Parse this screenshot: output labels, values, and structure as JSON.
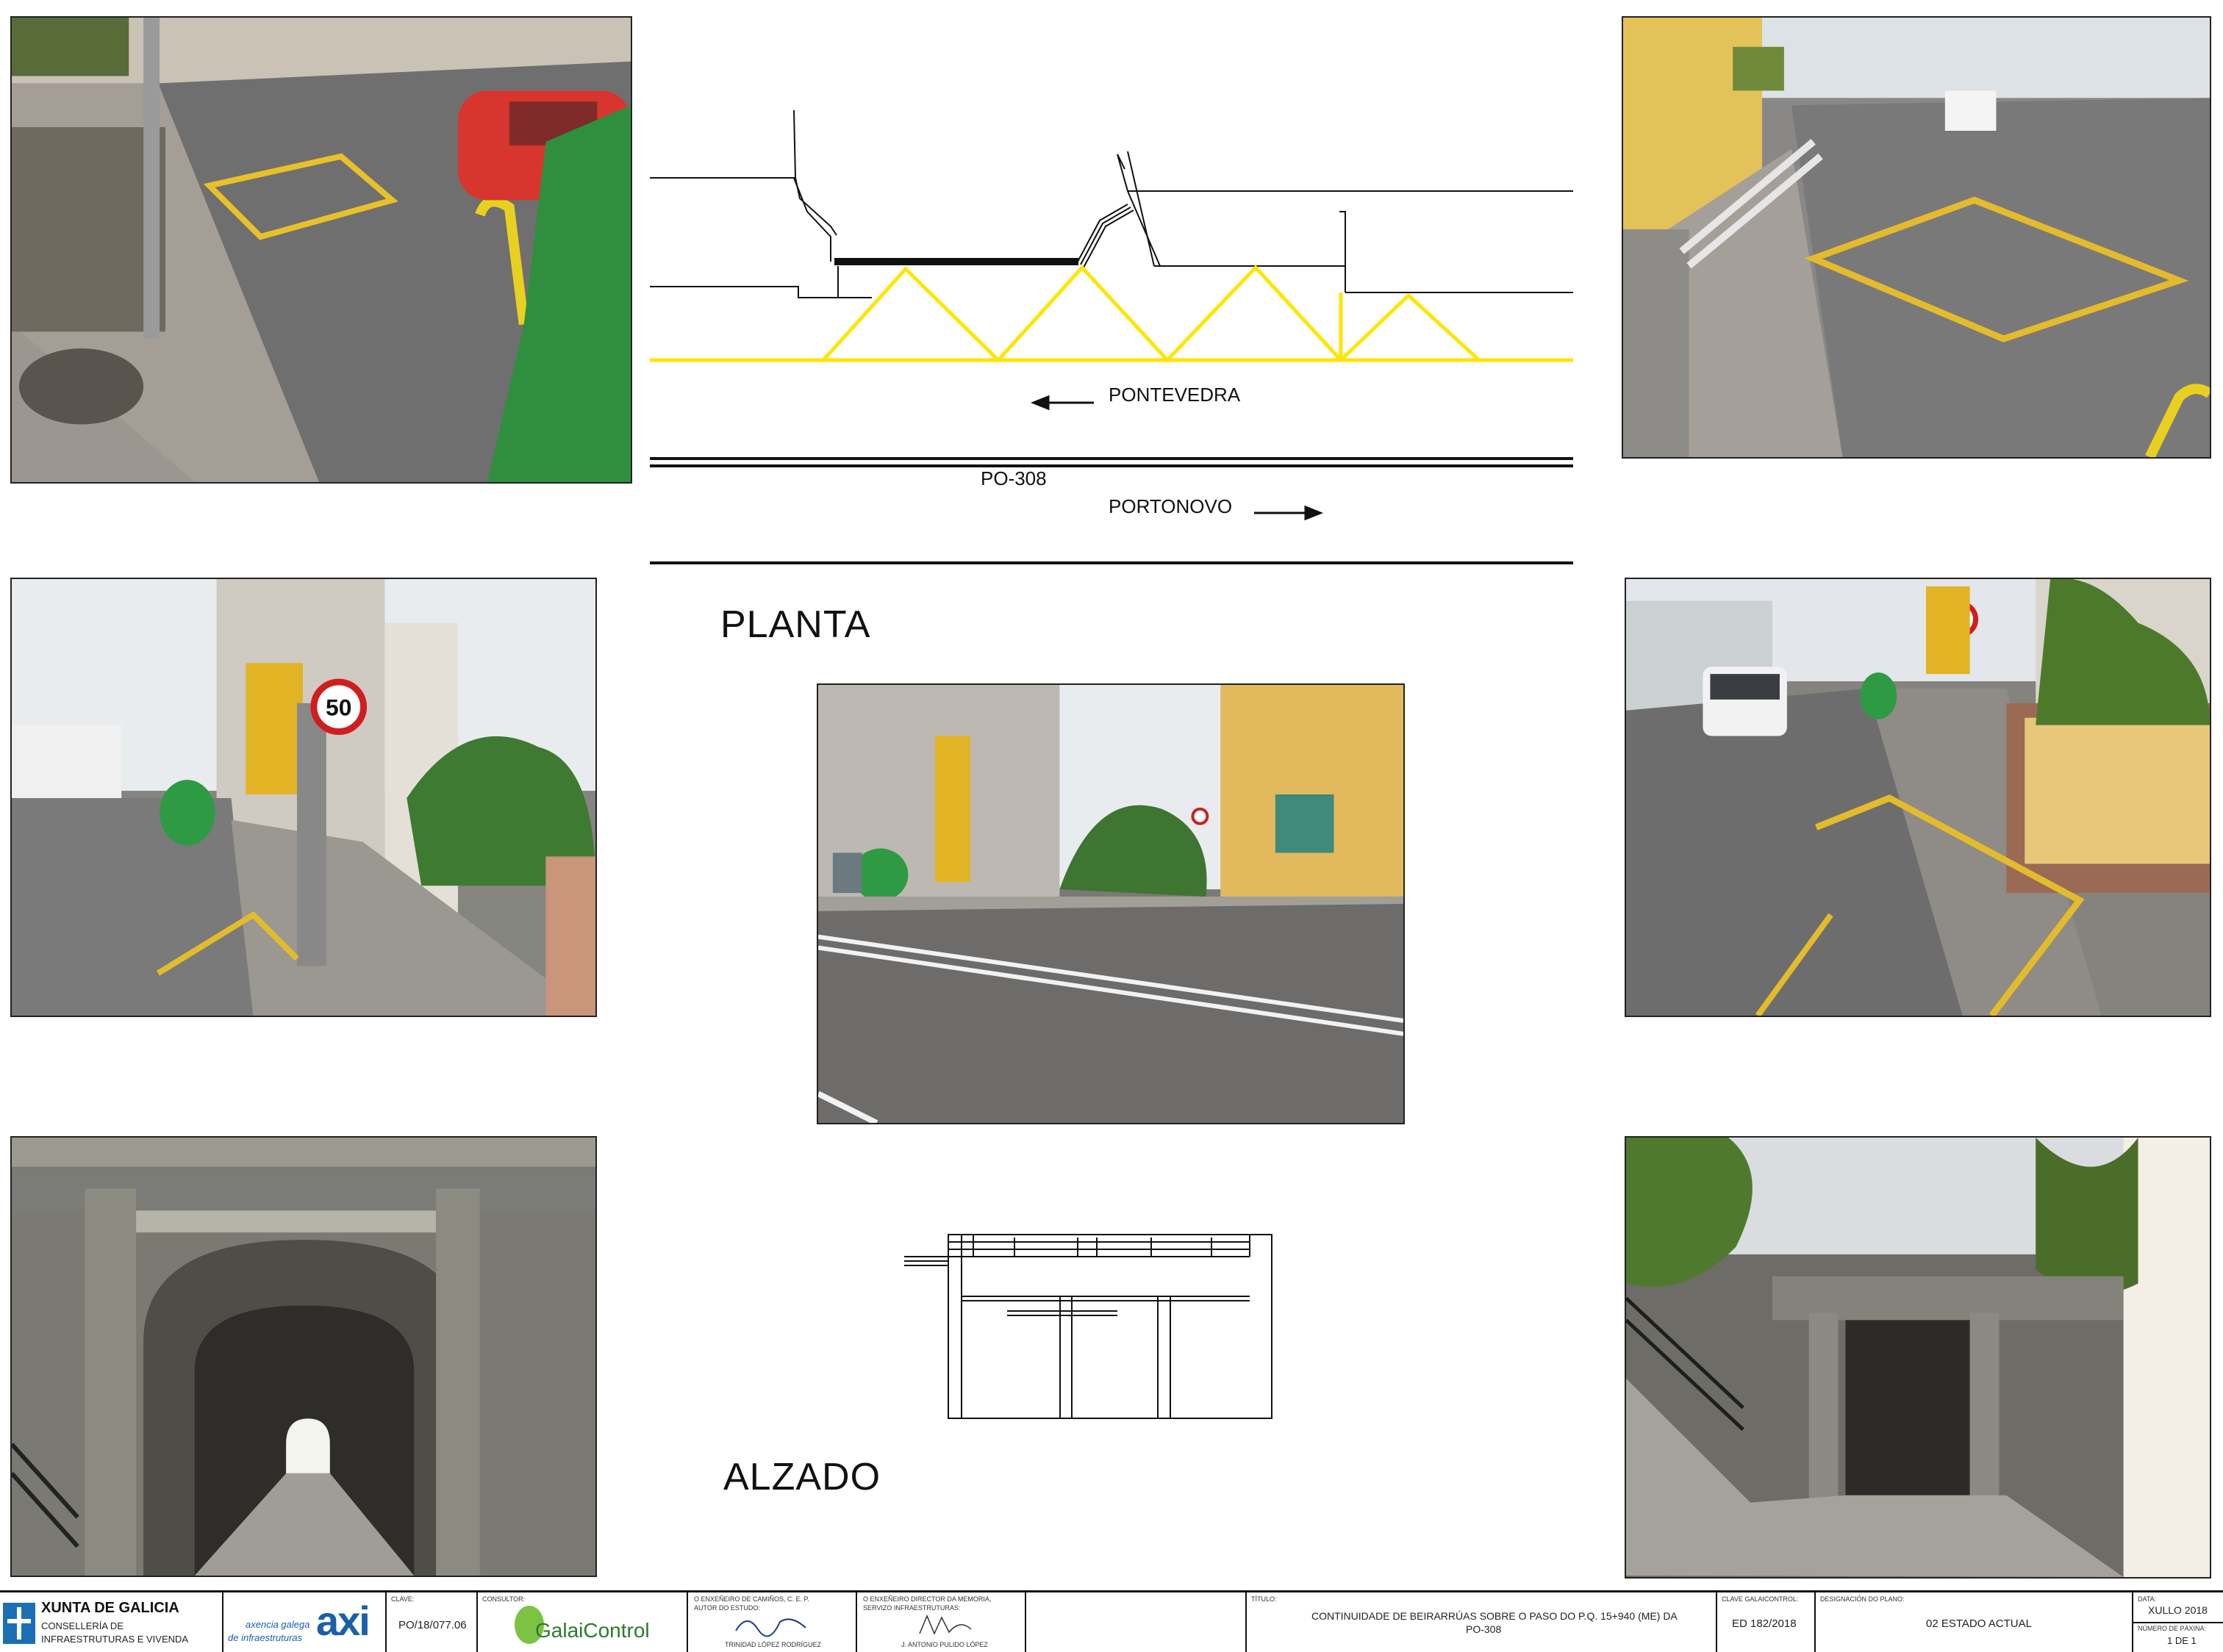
{
  "drawing": {
    "plan": {
      "heading": "PLANTA",
      "label_left_direction": "PONTEVEDRA",
      "label_road": "PO-308",
      "label_right_direction": "PORTONOVO"
    },
    "elevation": {
      "heading": "ALZADO"
    },
    "colors": {
      "road_marking_yellow": "#ffe500",
      "line": "#111111"
    }
  },
  "photos": [
    {
      "name": "photo-sidewalk-red-car",
      "scene": "street sidewalk with red car"
    },
    {
      "name": "photo-sidewalk-railing",
      "scene": "sidewalk with stair railing"
    },
    {
      "name": "photo-speed-sign-50-left",
      "scene": "street with speed limit sign"
    },
    {
      "name": "photo-road-center",
      "scene": "road crossing view"
    },
    {
      "name": "photo-van-street",
      "scene": "street with white van"
    },
    {
      "name": "photo-tunnel-front",
      "scene": "underpass tunnel"
    },
    {
      "name": "photo-underpass-stairs",
      "scene": "underpass with stairs"
    }
  ],
  "signs": {
    "speed_limit": "50"
  },
  "title_block": {
    "org_name": "XUNTA DE GALICIA",
    "org_dept_line1": "CONSELLERÍA DE",
    "org_dept_line2": "INFRAESTRUTURAS E VIVENDA",
    "agency_line1": "axencia galega",
    "agency_line2": "de infraestruturas",
    "agency_logo": "axi",
    "clave_caption": "CLAVE:",
    "clave_value": "PO/18/077.06",
    "consultor_caption": "CONSULTOR:",
    "consultor_value": "GalaiControl",
    "engineer_caption_line1": "O ENXEÑEIRO DE CAMIÑOS, C. E. P.",
    "engineer_caption_line2": "AUTOR DO ESTUDO:",
    "engineer_name": "TRINIDAD LÓPEZ RODRÍGUEZ",
    "director_caption_line1": "O ENXEÑEIRO DIRECTOR DA MEMORIA,",
    "director_caption_line2": "SERVIZO INFRAESTRUTURAS:",
    "director_name": "J. ANTONIO PULIDO LÓPEZ",
    "titulo_caption": "TÍTULO:",
    "titulo_line1": "CONTINUIDADE DE BEIRARRÚAS SOBRE O PASO DO P.Q. 15+940 (ME) DA",
    "titulo_line2": "PO-308",
    "clave_galaico_caption": "CLAVE GALAICONTROL:",
    "clave_galaico_value": "ED 182/2018",
    "designacion_caption": "DESIGNACIÓN DO PLANO:",
    "designacion_value": "02 ESTADO ACTUAL",
    "data_caption": "DATA:",
    "data_value": "XULLO 2018",
    "pagina_caption": "NÚMERO DE PÁXINA:",
    "pagina_value": "1 DE 1"
  }
}
